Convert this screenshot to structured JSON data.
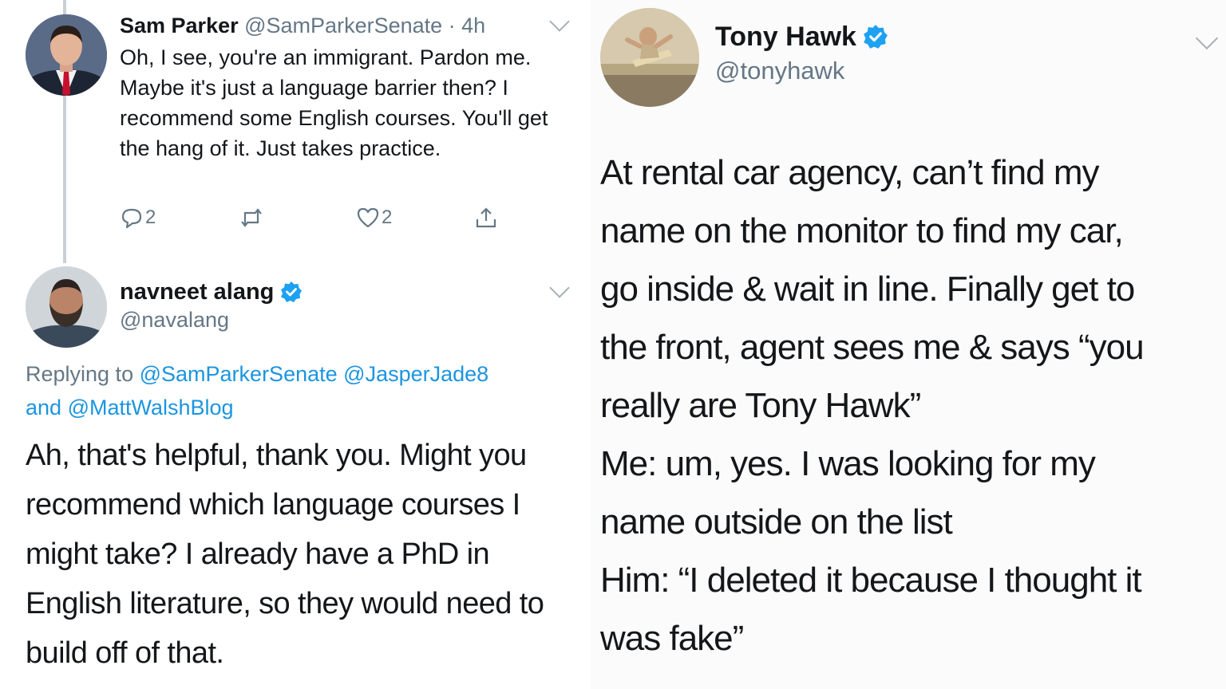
{
  "left_thread": {
    "first_tweet": {
      "name": "Sam Parker",
      "handle": "@SamParkerSenate",
      "time": "· 4h",
      "body": "Oh, I see, you're an immigrant. Pardon me. Maybe it's just a language barrier then? I recommend some English courses. You'll get the hang of it. Just takes practice.",
      "reply_count": "2",
      "like_count": "2",
      "avatar_icon": "avatar-man-in-suit"
    },
    "reply_tweet": {
      "name": "navneet alang",
      "handle": "@navalang",
      "replying_prefix": "Replying to",
      "replying_handle_1": "@SamParkerSenate",
      "replying_handle_2": "@JasperJade8",
      "replying_and": "and",
      "replying_handle_3": "@MattWalshBlog",
      "body": "Ah, that's helpful, thank you. Might you recommend which language courses I might take? I already have a PhD in English literature, so they would need to build off of that.",
      "avatar_icon": "avatar-bearded-man"
    }
  },
  "right_tweet": {
    "name": "Tony Hawk",
    "handle": "@tonyhawk",
    "avatar_icon": "avatar-skateboarder",
    "body_lines": [
      "At rental car agency, can’t find my",
      "name on the monitor to find my car,",
      "go inside & wait in line. Finally get to",
      "the front, agent sees me & says “you",
      "really are Tony Hawk”",
      "Me: um, yes. I was looking for my",
      "name outside on the list",
      "Him: “I deleted it because I thought it",
      "was fake”"
    ]
  },
  "colors": {
    "link": "#1b95e0",
    "muted": "#657786",
    "verified": "#1da1f2",
    "text": "#14171a"
  }
}
